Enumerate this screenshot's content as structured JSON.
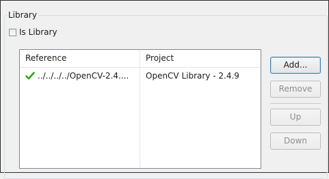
{
  "library": {
    "group_title": "Library",
    "is_library_label": "Is Library",
    "is_library_checked": false
  },
  "table": {
    "columns": [
      "Reference",
      "Project"
    ],
    "rows": [
      {
        "status_icon": "green-check-icon",
        "reference": "../../../../OpenCV-2.4....",
        "project": "OpenCV Library - 2.4.9"
      }
    ]
  },
  "buttons": {
    "add": "Add...",
    "remove": "Remove",
    "up": "Up",
    "down": "Down"
  },
  "colors": {
    "check_green": "#2ea316",
    "default_button_border": "#3c7fb1"
  }
}
